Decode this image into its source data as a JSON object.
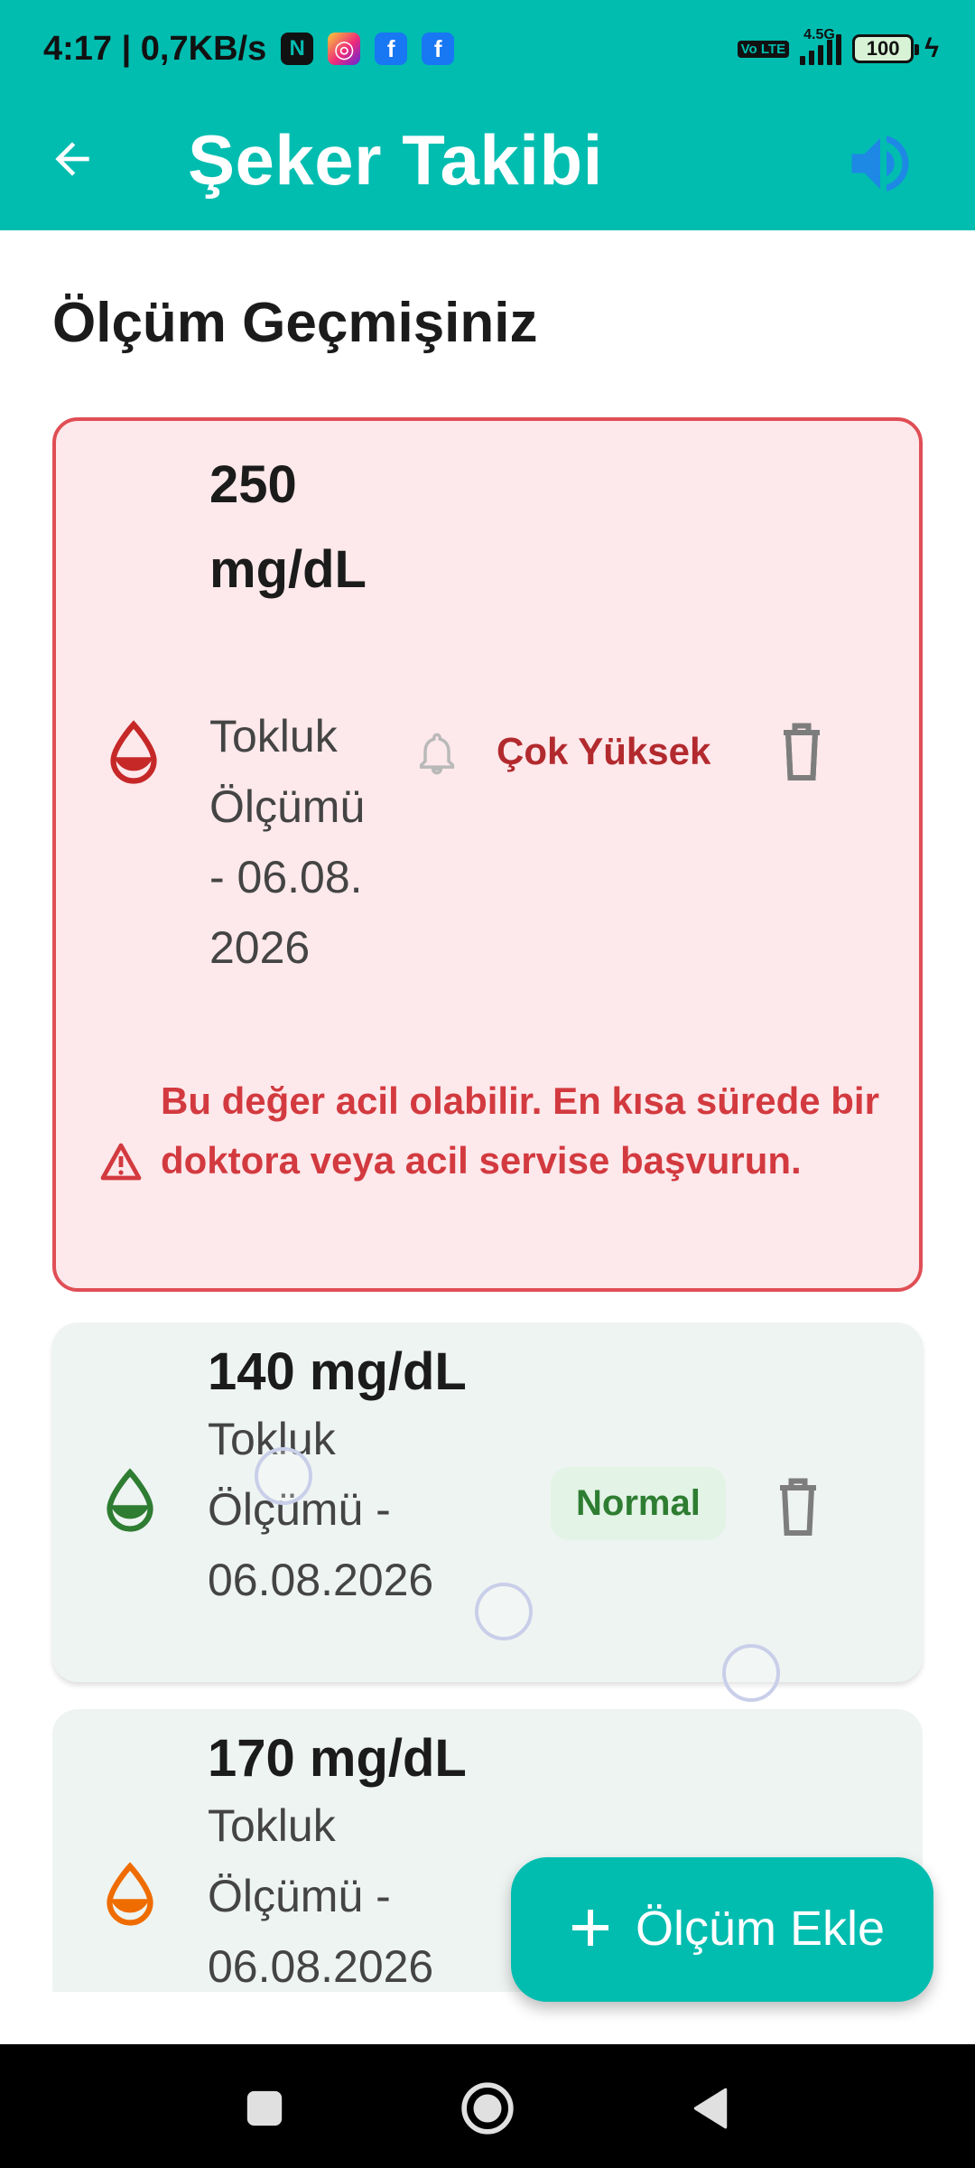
{
  "status_bar": {
    "time_speed": "4:17 | 0,7KB/s",
    "network_label": "4.5G",
    "volte_label": "Vo LTE",
    "battery": "100"
  },
  "app_bar": {
    "title": "Şeker Takibi",
    "back_icon": "arrow-left",
    "volume_icon": "volume"
  },
  "main": {
    "section_title": "Ölçüm Geçmişiniz",
    "measurements": [
      {
        "value": "250 mg/dL",
        "subtitle": "Tokluk Ölçümü - 06.08.2026",
        "status": "Çok Yüksek",
        "status_color": "#B22A2E",
        "drop_color": "#C62828",
        "alert": "Bu değer acil olabilir. En kısa sürede bir doktora veya acil servise başvurun."
      },
      {
        "value": "140 mg/dL",
        "subtitle": "Tokluk Ölçümü - 06.08.2026",
        "status": "Normal",
        "status_color": "#2E7D32",
        "drop_color": "#2E7D32"
      },
      {
        "value": "170 mg/dL",
        "subtitle": "Tokluk Ölçümü - 06.08.2026",
        "drop_color": "#EF6C00"
      }
    ]
  },
  "fab": {
    "label": "Ölçüm Ekle"
  },
  "colors": {
    "primary": "#00BDB0",
    "danger": "#E04E55",
    "danger_bg": "#FDE8EB",
    "card_bg": "#EEF4F2"
  }
}
